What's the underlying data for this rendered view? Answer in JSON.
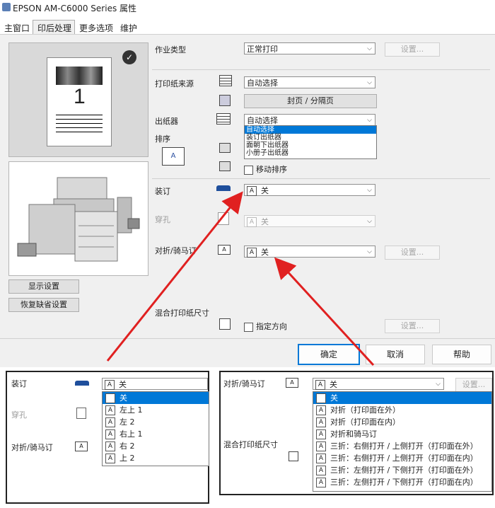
{
  "window": {
    "title": "EPSON AM-C6000 Series 属性"
  },
  "tabs": [
    "主窗口",
    "印后处理",
    "更多选项",
    "维护"
  ],
  "preview": {
    "page_number": "1"
  },
  "left_buttons": {
    "display_settings": "显示设置",
    "restore_defaults": "恢复缺省设置"
  },
  "settings": {
    "job_type": {
      "label": "作业类型",
      "value": "正常打印",
      "settings_button": "设置..."
    },
    "paper_source": {
      "label": "打印纸来源",
      "value": "自动选择",
      "cover_button": "封页 / 分隔页"
    },
    "output_tray": {
      "label": "出纸器",
      "value": "自动选择",
      "options": [
        "自动选择",
        "装订出纸器",
        "面朝下出纸器",
        "小册子出纸器"
      ]
    },
    "sort": {
      "label": "排序",
      "shift_sort": "移动排序"
    },
    "staple": {
      "label": "装订",
      "value": "关"
    },
    "punch": {
      "label": "穿孔",
      "value": "关"
    },
    "fold": {
      "label": "对折/骑马订",
      "value": "关",
      "settings_button": "设置..."
    },
    "mixed_size": {
      "label": "混合打印纸尺寸",
      "specify_orientation": "指定方向",
      "settings_button": "设置..."
    }
  },
  "dialog_buttons": {
    "ok": "确定",
    "cancel": "取消",
    "help": "帮助"
  },
  "inset_staple": {
    "staple_label": "装订",
    "punch_label": "穿孔",
    "fold_label": "对折/骑马订",
    "value": "关",
    "options": [
      "关",
      "左上 1",
      "左 2",
      "右上 1",
      "右 2",
      "上 2"
    ]
  },
  "inset_fold": {
    "fold_label": "对折/骑马订",
    "mixed_label": "混合打印纸尺寸",
    "value": "关",
    "settings_button": "设置...",
    "options": [
      "关",
      "对折（打印面在外）",
      "对折（打印面在内）",
      "对折和骑马订",
      "三折：右侧打开 / 上侧打开（打印面在外）",
      "三折：右侧打开 / 上侧打开（打印面在内）",
      "三折：左侧打开 / 下侧打开（打印面在外）",
      "三折：左侧打开 / 下侧打开（打印面在内）"
    ]
  },
  "colors": {
    "accent": "#0078d7",
    "arrow": "#e02020"
  }
}
